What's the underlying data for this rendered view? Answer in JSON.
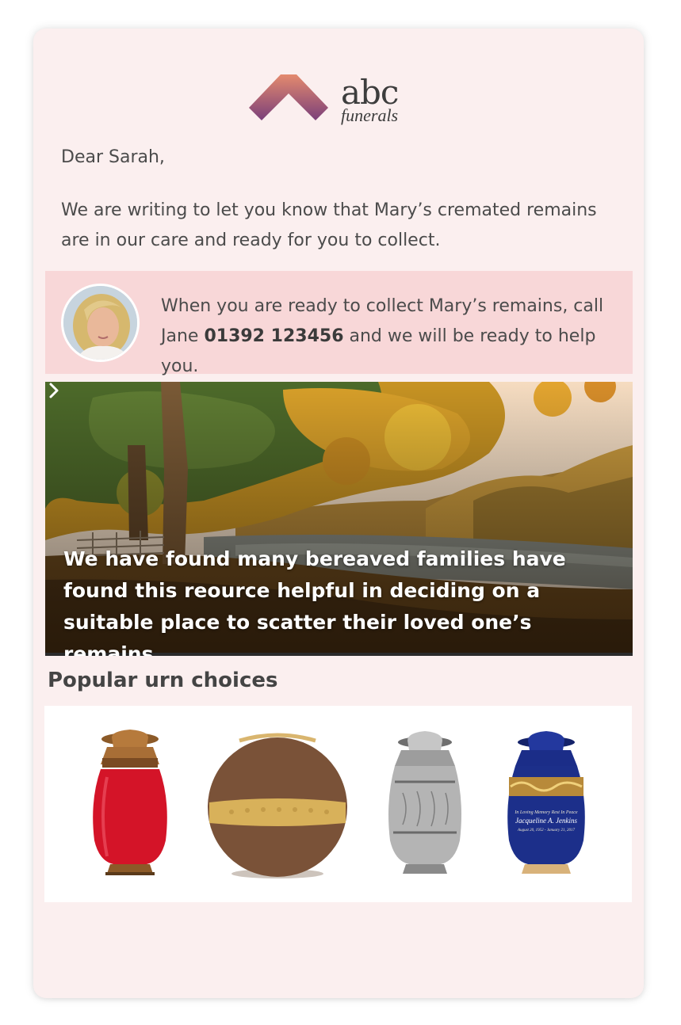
{
  "brand": {
    "name": "abc",
    "tagline": "funerals"
  },
  "letter": {
    "greeting": "Dear Sarah,",
    "intro": "We are writing to let you know that Mary’s cremated remains are in our care and ready for you to collect."
  },
  "contact": {
    "text_before": "When you are ready to collect Mary’s remains, call Jane ",
    "phone": "01392 123456",
    "text_after": " and we will be ready to help you."
  },
  "hero": {
    "text": "We have found many bereaved families have found this reource helpful in deciding on a suitable place to scatter their loved one’s remains",
    "chevron_icon": "chevron-right-icon"
  },
  "urns": {
    "title": "Popular urn choices",
    "items": [
      {
        "icon": "red-brass-urn-icon",
        "color": "#c8102e"
      },
      {
        "icon": "brown-sphere-urn-icon",
        "color": "#7a5238"
      },
      {
        "icon": "silver-engraved-urn-icon",
        "color": "#a7a7a7"
      },
      {
        "icon": "blue-gold-urn-icon",
        "color": "#1c2f8a",
        "engraving": [
          "In Loving Memory Rest In Peace",
          "Jacqueline A. Jenkins",
          "August 20, 1952 - January 21, 2017"
        ]
      }
    ]
  },
  "colors": {
    "card_bg": "#fbefef",
    "contact_bg": "#f8d7d8",
    "logo_gradient": [
      "#7a3f7a",
      "#e48a6e"
    ]
  }
}
